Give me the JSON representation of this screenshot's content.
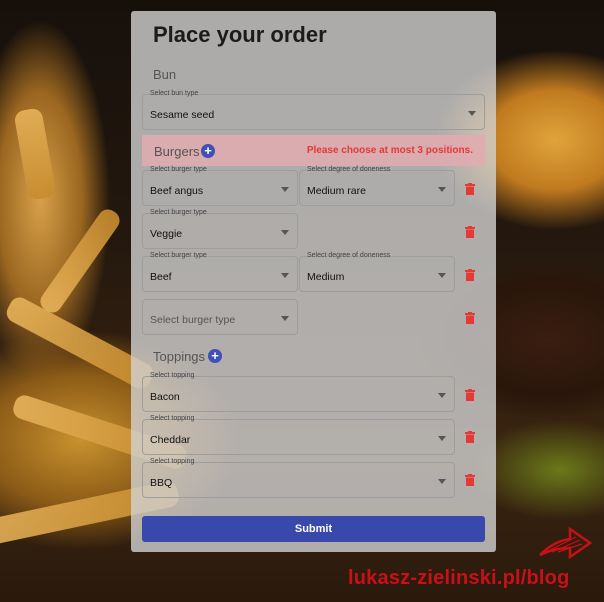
{
  "page": {
    "title": "Place your order"
  },
  "bun": {
    "section_label": "Bun",
    "caption": "Select bun type",
    "value": "Sesame seed"
  },
  "burgers": {
    "section_label": "Burgers",
    "error": "Please choose at most 3 positions.",
    "rows": [
      {
        "type_caption": "Select burger type",
        "type_value": "Beef angus",
        "doneness_caption": "Select degree of doneness",
        "doneness_value": "Medium rare"
      },
      {
        "type_caption": "Select burger type",
        "type_value": "Veggie"
      },
      {
        "type_caption": "Select burger type",
        "type_value": "Beef",
        "doneness_caption": "Select degree of doneness",
        "doneness_value": "Medium"
      },
      {
        "type_placeholder": "Select burger type"
      }
    ]
  },
  "toppings": {
    "section_label": "Toppings",
    "rows": [
      {
        "caption": "Select topping",
        "value": "Bacon"
      },
      {
        "caption": "Select topping",
        "value": "Cheddar"
      },
      {
        "caption": "Select topping",
        "value": "BBQ"
      }
    ]
  },
  "actions": {
    "submit_label": "Submit"
  },
  "watermark": {
    "text": "lukasz-zielinski.pl/blog"
  },
  "colors": {
    "accent": "#3f51b5",
    "submit": "#3949ab",
    "error": "#e53935",
    "delete": "#e53935",
    "watermark": "#c8101a"
  },
  "icons": {
    "add": "plus-circle-icon",
    "delete": "trash-icon",
    "dropdown": "caret-down-icon"
  }
}
